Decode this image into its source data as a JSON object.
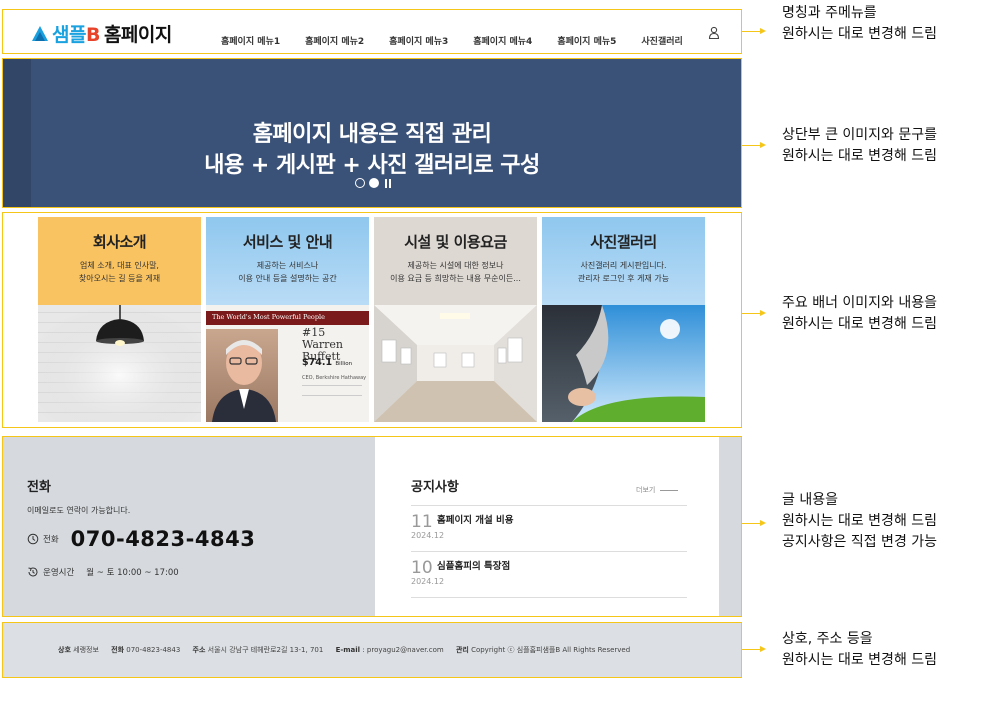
{
  "header": {
    "logo_a": "샘플",
    "logo_b": "B",
    "logo_c": "홈페이지",
    "menu": [
      "홈페이지 메뉴1",
      "홈페이지 메뉴2",
      "홈페이지 메뉴3",
      "홈페이지 메뉴4",
      "홈페이지 메뉴5",
      "사진갤러리"
    ]
  },
  "hero": {
    "line1": "홈페이지 내용은 직접 관리",
    "line2": "내용 + 게시판 + 사진 갤러리로 구성"
  },
  "banners": [
    {
      "title": "회사소개",
      "d1": "업체 소개, 대표 인사말,",
      "d2": "찾아오시는 길 등을 게재",
      "bg": "#f9c362"
    },
    {
      "title": "서비스 및 안내",
      "d1": "제공하는 서비스나",
      "d2": "이용 안내 등을 설명하는 공간",
      "bg": "#8fc7ee",
      "img": {
        "head": "The World's Most Powerful People",
        "rank": "#15 Warren",
        "name": "Buffett",
        "worth": "$74.1",
        "unit": "Billion",
        "role": "CEO, Berkshire Hathaway"
      }
    },
    {
      "title": "시설 및 이용요금",
      "d1": "제공하는 시설에 대한 정보나",
      "d2": "이용 요금 등 희망하는 내용 무순이든...",
      "bg": "#ddd8d2"
    },
    {
      "title": "사진갤러리",
      "d1": "사진갤러리 게시판입니다.",
      "d2": "관리자 로그인 후 게재 가능",
      "bg": "#8fc7ee"
    }
  ],
  "contact": {
    "title": "전화",
    "sub": "이메일로도 연락이 가능합니다.",
    "phone_label": "전화",
    "phone": "070-4823-4843",
    "hours_label": "운영시간",
    "hours": "월 ~ 토 10:00 ~ 17:00"
  },
  "notice": {
    "title": "공지사항",
    "more": "더보기",
    "posts": [
      {
        "day": "11",
        "title": "홈페이지 개설 비용",
        "ym": "2024.12"
      },
      {
        "day": "10",
        "title": "심플홈피의 특장점",
        "ym": "2024.12"
      }
    ]
  },
  "footer": {
    "k1": "상호",
    "v1": "세랭정보",
    "k2": "전화",
    "v2": "070-4823-4843",
    "k3": "주소",
    "v3": "서울시 강남구 테헤란로2길 13-1, 701",
    "k4": "E-mail",
    "v4": ": proyagu2@naver.com",
    "k5": "관리",
    "v5": "Copyright ⓒ 심플홈피샘플B All Rights Reserved"
  },
  "notes": [
    {
      "l1": "명칭과 주메뉴를",
      "l2": "원하시는 대로 변경해 드림"
    },
    {
      "l1": "상단부 큰 이미지와 문구를",
      "l2": "원하시는 대로 변경해 드림"
    },
    {
      "l1": "주요 배너 이미지와 내용을",
      "l2": "원하시는 대로 변경해 드림"
    },
    {
      "l1": "글 내용을",
      "l2": "원하시는 대로 변경해 드림",
      "l3": "공지사항은 직접 변경 가능"
    },
    {
      "l1": "상호, 주소 등을",
      "l2": "원하시는 대로 변경해 드림"
    }
  ],
  "colors": {
    "accent": "#f5c518",
    "hero": "#3b5278",
    "panel": "#d6dade"
  }
}
